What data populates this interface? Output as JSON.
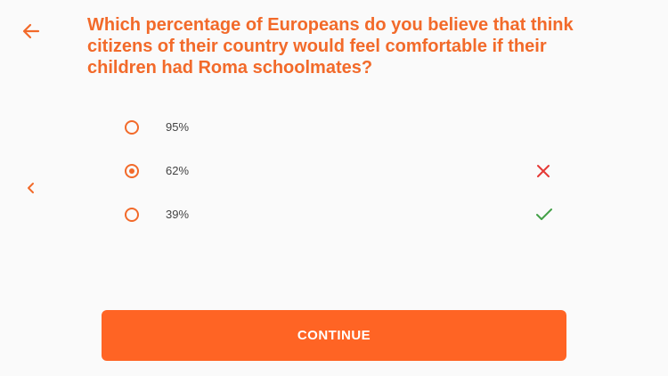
{
  "colors": {
    "accent": "#f26a2a",
    "button": "#ff6424",
    "wrong": "#e53935",
    "correct": "#43a047",
    "background": "#fafafa"
  },
  "header": {
    "back_icon": "arrow-left-icon"
  },
  "question": {
    "text": "Which percentage of Europeans do you believe that think citizens of their country would feel comfortable if their children had Roma schoolmates?"
  },
  "nav": {
    "prev_icon": "chevron-left-icon"
  },
  "options": [
    {
      "label": "95%",
      "selected": false,
      "result": ""
    },
    {
      "label": "62%",
      "selected": true,
      "result": "wrong"
    },
    {
      "label": "39%",
      "selected": false,
      "result": "correct"
    }
  ],
  "footer": {
    "continue_label": "CONTINUE"
  }
}
